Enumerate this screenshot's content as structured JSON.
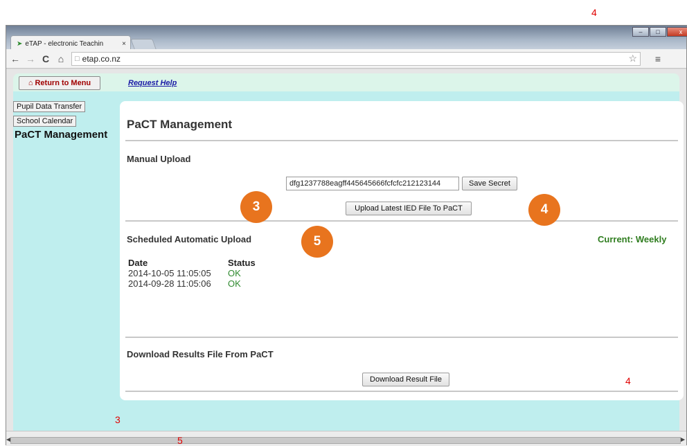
{
  "annotations": {
    "red_top_right": "4",
    "red_panel_right": "4",
    "red_bottom_left": "3",
    "red_bottom_center": "5",
    "orange_secret_left": "3",
    "orange_secret_right": "4",
    "orange_upload": "5"
  },
  "browser": {
    "tab_title": "eTAP - electronic Teachin",
    "tab_close": "×",
    "url": "etap.co.nz",
    "win_min": "–",
    "win_max": "□",
    "win_close": "x",
    "back_glyph": "←",
    "forward_glyph": "→",
    "reload_glyph": "C",
    "home_glyph": "⌂",
    "star_glyph": "☆",
    "menu_glyph": "≡"
  },
  "topbar": {
    "return_label": "Return to Menu",
    "request_help": "Request Help"
  },
  "sidebar": {
    "items": [
      {
        "label": "Pupil Data Transfer"
      },
      {
        "label": "School Calendar"
      }
    ],
    "current": "PaCT Management"
  },
  "main": {
    "title": "PaCT Management",
    "manual_upload": {
      "heading": "Manual Upload",
      "secret_value": "dfg1237788eagff445645666fcfcfc212123144",
      "save_label": "Save Secret",
      "upload_label": "Upload Latest IED File To PaCT"
    },
    "scheduled": {
      "heading": "Scheduled Automatic Upload",
      "current": "Current: Weekly",
      "columns": [
        "Date",
        "Status"
      ],
      "rows": [
        {
          "date": "2014-10-05 11:05:05",
          "status": "OK"
        },
        {
          "date": "2014-09-28 11:05:06",
          "status": "OK"
        }
      ]
    },
    "download": {
      "heading": "Download Results File From PaCT",
      "button_label": "Download Result File"
    }
  },
  "colors": {
    "accent_orange": "#e8741e",
    "status_green": "#2f8a2f",
    "sidebar_bg": "#bfeeee",
    "link_blue": "#1a1aa6",
    "return_red": "#a00000"
  }
}
